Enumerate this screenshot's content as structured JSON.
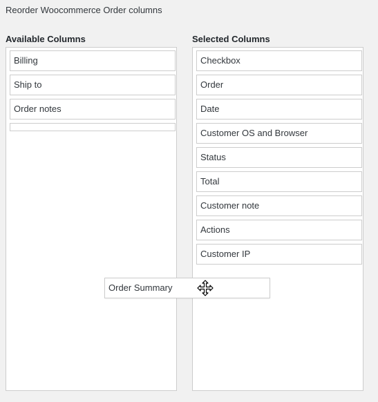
{
  "page": {
    "title": "Reorder Woocommerce Order columns"
  },
  "available": {
    "heading": "Available Columns",
    "items": [
      {
        "label": "Billing"
      },
      {
        "label": "Ship to"
      },
      {
        "label": "Order notes"
      }
    ]
  },
  "selected": {
    "heading": "Selected Columns",
    "items": [
      {
        "label": "Checkbox"
      },
      {
        "label": "Order"
      },
      {
        "label": "Date"
      },
      {
        "label": "Customer OS and Browser"
      },
      {
        "label": "Status"
      },
      {
        "label": "Total"
      },
      {
        "label": "Customer note"
      },
      {
        "label": "Actions"
      },
      {
        "label": "Customer IP"
      }
    ]
  },
  "dragging": {
    "label": "Order Summary",
    "cursor_icon": "move-cursor-icon"
  },
  "colors": {
    "background": "#f1f1f1",
    "box_border": "#cccccc",
    "item_background": "#ffffff"
  }
}
